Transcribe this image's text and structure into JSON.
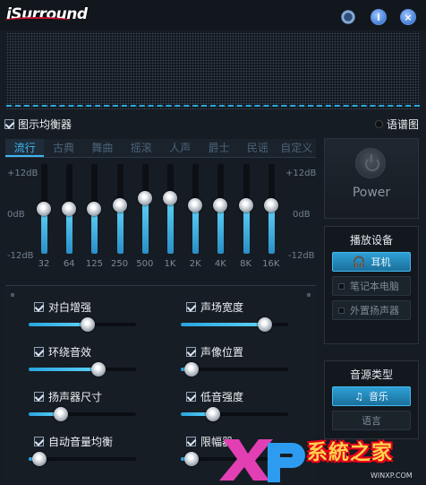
{
  "app": {
    "name": "iSurround"
  },
  "titlebar": {
    "settings": "gear-icon",
    "info": "info-icon",
    "close": "close-icon"
  },
  "eq": {
    "enable_label": "图示均衡器",
    "enable_checked": true,
    "spectrum_label": "语谱图",
    "tabs": [
      "流行",
      "古典",
      "舞曲",
      "摇滚",
      "人声",
      "爵士",
      "民谣",
      "自定义"
    ],
    "active_tab": "流行",
    "db_top": "+12dB",
    "db_mid": "0dB",
    "db_bot": "-12dB",
    "bands": [
      {
        "freq": "32",
        "gain": 0
      },
      {
        "freq": "64",
        "gain": 0
      },
      {
        "freq": "125",
        "gain": 0
      },
      {
        "freq": "250",
        "gain": 1
      },
      {
        "freq": "500",
        "gain": 3
      },
      {
        "freq": "1K",
        "gain": 3
      },
      {
        "freq": "2K",
        "gain": 1
      },
      {
        "freq": "4K",
        "gain": 1
      },
      {
        "freq": "8K",
        "gain": 1
      },
      {
        "freq": "16K",
        "gain": 1
      }
    ]
  },
  "power": {
    "label": "Power"
  },
  "playback": {
    "title": "播放设备",
    "options": [
      {
        "label": "耳机",
        "selected": true
      },
      {
        "label": "笔记本电脑",
        "selected": false
      },
      {
        "label": "外置扬声器",
        "selected": false
      }
    ]
  },
  "source": {
    "title": "音源类型",
    "options": [
      {
        "label": "音乐",
        "selected": true
      },
      {
        "label": "语言",
        "selected": false
      }
    ]
  },
  "effects": [
    {
      "label": "对白增强",
      "checked": true,
      "level": 0.55
    },
    {
      "label": "声场宽度",
      "checked": true,
      "level": 0.78
    },
    {
      "label": "环绕音效",
      "checked": true,
      "level": 0.65
    },
    {
      "label": "声像位置",
      "checked": true,
      "level": 0.1
    },
    {
      "label": "扬声器尺寸",
      "checked": true,
      "level": 0.3
    },
    {
      "label": "低音强度",
      "checked": true,
      "level": 0.3
    },
    {
      "label": "自动音量均衡",
      "checked": true,
      "level": 0.1
    },
    {
      "label": "限幅器",
      "checked": true,
      "level": 0.1
    }
  ],
  "watermark": {
    "text": "系統之家",
    "brand": "XP",
    "url": "WINXP.COM"
  },
  "colors": {
    "accent": "#3fb6f0",
    "background": "#161c23",
    "brand_red": "#c8102e",
    "watermark_pink": "#e23fb5",
    "watermark_blue": "#2d9cf0"
  }
}
